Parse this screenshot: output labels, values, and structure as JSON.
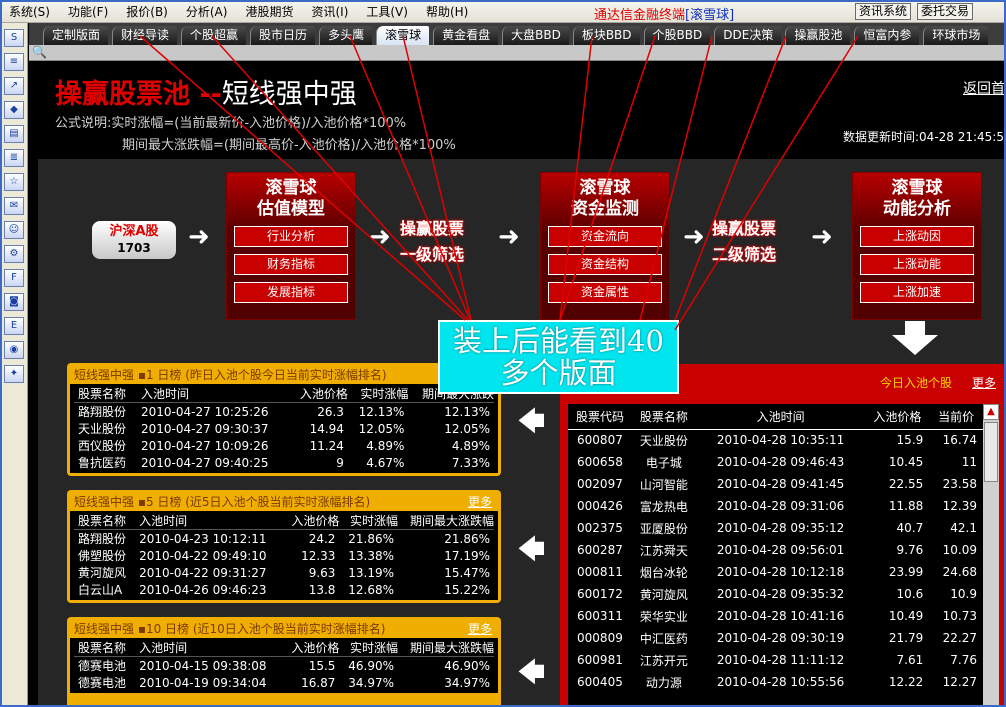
{
  "menu": [
    "系统(S)",
    "功能(F)",
    "报价(B)",
    "分析(A)",
    "港股期货",
    "资讯(I)",
    "工具(V)",
    "帮助(H)"
  ],
  "app_title": {
    "name": "通达信金融终端",
    "tag": "[滚雪球]"
  },
  "top_buttons": [
    "资讯系统",
    "委托交易"
  ],
  "sidebar_icons": [
    "S",
    "≡",
    "↗",
    "◆",
    "▤",
    "≣",
    "☆",
    "✉",
    "☺",
    "⚙",
    "F",
    "◙",
    "E",
    "◉",
    "✦"
  ],
  "tabs": [
    "定制版面",
    "财经导读",
    "个股超赢",
    "股市日历",
    "多头鹰",
    "滚雪球",
    "黄金看盘",
    "大盘BBD",
    "板块BBD",
    "个股BBD",
    "DDE决策",
    "操赢股池",
    "恒富内参",
    "环球市场"
  ],
  "active_tab": 5,
  "header": {
    "title_red": "操赢股票池",
    "title_dash": " --",
    "title_white": "短线强中强",
    "back": "返回首",
    "formula_label": "公式说明:",
    "formula1": "实时涨幅=(当前最新价-入池价格)/入池价格*100%",
    "formula2": "期间最大涨跌幅=(期间最高价-入池价格)/入池价格*100%",
    "updated": "数据更新时间:04-28 21:45:5"
  },
  "market": {
    "name": "沪深A股",
    "count": "1703"
  },
  "model1": {
    "title1": "滚雪球",
    "title2": "估值模型",
    "buttons": [
      "行业分析",
      "财务指标",
      "发展指标"
    ]
  },
  "model2": {
    "title1": "滚雪球",
    "title2": "资金监测",
    "buttons": [
      "资金流向",
      "资金结构",
      "资金属性"
    ]
  },
  "model3": {
    "title1": "滚雪球",
    "title2": "动能分析",
    "buttons": [
      "上涨动因",
      "上涨动能",
      "上涨加速"
    ]
  },
  "stage1": {
    "l1": "操赢股票",
    "l2": "一级筛选"
  },
  "stage2": {
    "l1": "操赢股票",
    "l2": "二级筛选"
  },
  "callout": {
    "l1": "装上后能看到40",
    "l2": "多个版面"
  },
  "panels": [
    {
      "title": "短线强中强 ▪1 日榜 (昨日入池个股今日当前实时涨幅排名)",
      "more": "",
      "headers": [
        "股票名称",
        "入池时间",
        "入池价格",
        "实时涨幅",
        "期间最大涨跌"
      ],
      "rows": [
        [
          "路翔股份",
          "2010-04-27 10:25:26",
          "26.3",
          "12.13%",
          "12.13%"
        ],
        [
          "天业股份",
          "2010-04-27 09:30:37",
          "14.94",
          "12.05%",
          "12.05%"
        ],
        [
          "西仪股份",
          "2010-04-27 10:09:26",
          "11.24",
          "4.89%",
          "4.89%"
        ],
        [
          "鲁抗医药",
          "2010-04-27 09:40:25",
          "9",
          "4.67%",
          "7.33%"
        ]
      ]
    },
    {
      "title": "短线强中强 ▪5 日榜 (近5日入池个股当前实时涨幅排名)",
      "more": "更多",
      "headers": [
        "股票名称",
        "入池时间",
        "入池价格",
        "实时涨幅",
        "期间最大涨跌幅"
      ],
      "rows": [
        [
          "路翔股份",
          "2010-04-23 10:12:11",
          "24.2",
          "21.86%",
          "21.86%"
        ],
        [
          "佛塑股份",
          "2010-04-22 09:49:10",
          "12.33",
          "13.38%",
          "17.19%"
        ],
        [
          "黄河旋风",
          "2010-04-22 09:31:27",
          "9.63",
          "13.19%",
          "15.47%"
        ],
        [
          "白云山A",
          "2010-04-26 09:46:23",
          "13.8",
          "12.68%",
          "15.22%"
        ]
      ]
    },
    {
      "title": "短线强中强 ▪10 日榜 (近10日入池个股当前实时涨幅排名)",
      "more": "更多",
      "headers": [
        "股票名称",
        "入池时间",
        "入池价格",
        "实时涨幅",
        "期间最大涨跌幅"
      ],
      "rows": [
        [
          "德赛电池",
          "2010-04-15 09:38:08",
          "15.5",
          "46.90%",
          "46.90%"
        ],
        [
          "德赛电池",
          "2010-04-19 09:34:04",
          "16.87",
          "34.97%",
          "34.97%"
        ]
      ]
    }
  ],
  "today": {
    "label": "今日入池个股",
    "more": "更多",
    "headers": [
      "股票代码",
      "股票名称",
      "入池时间",
      "入池价格",
      "当前价"
    ],
    "rows": [
      [
        "600807",
        "天业股份",
        "2010-04-28 10:35:11",
        "15.9",
        "16.74"
      ],
      [
        "600658",
        "电子城",
        "2010-04-28 09:46:43",
        "10.45",
        "11"
      ],
      [
        "002097",
        "山河智能",
        "2010-04-28 09:41:45",
        "22.55",
        "23.58"
      ],
      [
        "000426",
        "富龙热电",
        "2010-04-28 09:31:06",
        "11.88",
        "12.39"
      ],
      [
        "002375",
        "亚厦股份",
        "2010-04-28 09:35:12",
        "40.7",
        "42.1"
      ],
      [
        "600287",
        "江苏舜天",
        "2010-04-28 09:56:01",
        "9.76",
        "10.09"
      ],
      [
        "000811",
        "烟台冰轮",
        "2010-04-28 10:12:18",
        "23.99",
        "24.68"
      ],
      [
        "600172",
        "黄河旋风",
        "2010-04-28 09:35:32",
        "10.6",
        "10.9"
      ],
      [
        "600311",
        "荣华实业",
        "2010-04-28 10:41:16",
        "10.49",
        "10.73"
      ],
      [
        "000809",
        "中汇医药",
        "2010-04-28 09:30:19",
        "21.79",
        "22.27"
      ],
      [
        "600981",
        "江苏开元",
        "2010-04-28 11:11:12",
        "7.61",
        "7.76"
      ],
      [
        "600405",
        "动力源",
        "2010-04-28 10:55:56",
        "12.22",
        "12.27"
      ]
    ]
  }
}
